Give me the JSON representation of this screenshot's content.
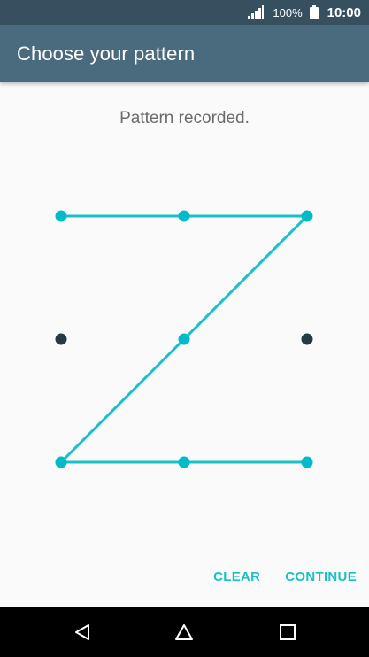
{
  "status_bar": {
    "battery_percent": "100%",
    "time": "10:00"
  },
  "header": {
    "title": "Choose your pattern"
  },
  "pattern": {
    "message": "Pattern recorded.",
    "grid": 3,
    "sequence": [
      1,
      2,
      3,
      5,
      7,
      8,
      9
    ],
    "colors": {
      "line": "#1ac0c6",
      "active_dot": "#00bcc8",
      "inactive_dot": "#263a45"
    }
  },
  "actions": {
    "clear_label": "CLEAR",
    "continue_label": "CONTINUE"
  },
  "nav": {
    "icons": [
      "back-icon",
      "home-icon",
      "recents-icon"
    ]
  }
}
